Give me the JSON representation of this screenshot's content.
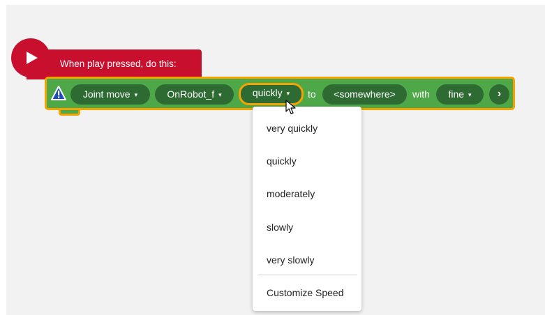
{
  "event_block": {
    "label": "When play pressed, do this:",
    "play_icon": "play-icon"
  },
  "action_block": {
    "warning_icon": "warning-icon",
    "command": "Joint move",
    "tool": "OnRobot_f",
    "speed": "quickly",
    "to_text": "to",
    "target": "<somewhere>",
    "with_text": "with",
    "blend": "fine",
    "more_icon": "chevron-right-icon",
    "caret": "▾"
  },
  "speed_menu": {
    "items": [
      "very quickly",
      "quickly",
      "moderately",
      "slowly",
      "very slowly"
    ],
    "customize": "Customize Speed"
  },
  "colors": {
    "event_red": "#c8102e",
    "block_green": "#4ea848",
    "pill_green": "#2e6b33",
    "selection_orange": "#f5a300"
  }
}
